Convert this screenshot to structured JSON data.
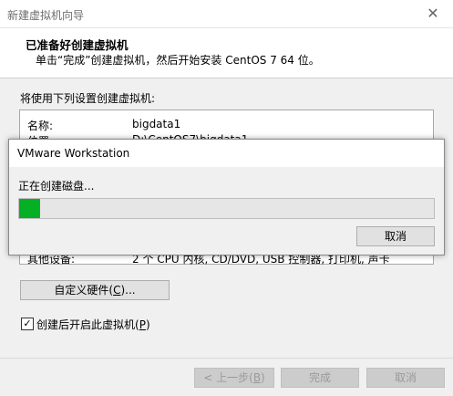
{
  "wizard": {
    "title": "新建虚拟机向导",
    "close_glyph": "✕",
    "header_title": "已准备好创建虚拟机",
    "header_subtitle": "单击“完成”创建虚拟机，然后开始安装 CentOS 7 64 位。",
    "section_label": "将使用下列设置创建虚拟机:",
    "summary": [
      {
        "label": "名称:",
        "value": "bigdata1"
      },
      {
        "label": "位置:",
        "value": "D:\\CentOS7\\bigdata1"
      },
      {
        "label": "其他设备:",
        "value": "2 个 CPU 内核, CD/DVD, USB 控制器, 打印机, 声卡"
      }
    ],
    "customize_button": {
      "text": "自定义硬件(",
      "key": "C",
      "suffix": ")..."
    },
    "power_on_checkbox": {
      "checked": true,
      "text": "创建后开启此虚拟机(",
      "key": "P",
      "suffix": ")"
    },
    "buttons": {
      "back": {
        "text": "< 上一步(",
        "key": "B",
        "suffix": ")"
      },
      "finish": "完成",
      "cancel": "取消"
    }
  },
  "dialog": {
    "title": "VMware Workstation",
    "status": "正在创建磁盘...",
    "progress": 0.05,
    "progress_color": "#06b025",
    "cancel": "取消"
  }
}
